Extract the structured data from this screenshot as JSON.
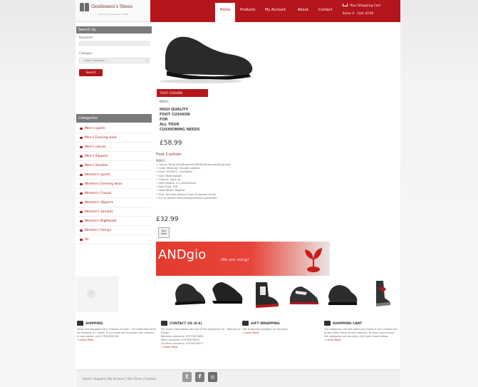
{
  "header": {
    "logo_text": "Gentlemen's Shoes",
    "logo_tagline": "Quality footwear since 1985",
    "nav": [
      "Home",
      "Products",
      "My Account",
      "About",
      "Contact"
    ],
    "cart_title": "Your Shopping Cart",
    "cart_items": "Items: 0",
    "cart_cost": "Cost: £0.00"
  },
  "search": {
    "heading": "Search by",
    "keywords_label": "Keywords",
    "category_label": "Category",
    "category_value": "-- Select Category --",
    "button_label": "Search"
  },
  "categories": {
    "heading": "Categories",
    "items": [
      "Men's sports",
      "Men's Evening wear",
      "Men's casual",
      "Men's Slippers",
      "Men's Sandals",
      "Women's sports",
      "Women's Evening wear",
      "Women's Casual",
      "Women's Slippers",
      "Women's Sandals",
      "Women's Nightwear",
      "Women's Pumps",
      "All"
    ]
  },
  "product": {
    "title": "FOOT CUSHION",
    "brand": "MEN'S",
    "description": [
      "HIGH QUALITY",
      "FOOT CUSHION",
      "FOR",
      "ALL YOUR",
      "CUSHIONING NEEDS"
    ],
    "price": "£58.99",
    "sub_title_prefix": "Foot",
    "sub_title_accent": "Cushion",
    "sub_brand": "MEN'S",
    "specs": [
      "Colour: Burgundy/Burgundy/White Burgundy/Burgundy",
      "Outer Material: Smooth Leather",
      "Inner: ROSSI'S - Synthetic",
      "Sole: Both Rubber",
      "Closure: Lace-up",
      "Heel Height: 1-2 centimetres",
      "Heel Type: Flat",
      "Shoe Width: Regular",
      "Free, tax-free delivery from European Union",
      "Full or partial refund/replacement guarantee"
    ],
    "price2": "£32.99",
    "buy_label_1": "Buy",
    "buy_label_2": "Now"
  },
  "banner": {
    "brand": "ANDgio",
    "tagline": "- We are rising!"
  },
  "footer": {
    "columns": [
      {
        "heading": "SHIPPING",
        "text": "Items are shipped every Tuesday at 3pm. The estimated time for delivery is 1 week. If you have not received your product in two weeks, call 07525656785.",
        "link": "» Learn More"
      },
      {
        "heading": "CONTACT US (9-6)",
        "text": "For more information call one of the following 9-6 - Monday to Friday:",
        "bullets": [
          "Womens products: 07071825691",
          "Mens products: 07976479876",
          "All other concerns: 07534749217"
        ],
        "link": "» Learn More"
      },
      {
        "heading": "GIFT WRAPPING",
        "text": "Gift wrapping available at checkout",
        "link": "» Learn More"
      },
      {
        "heading": "SHOPPING CART",
        "text": "Our shopping cart will store your items if you choose not to purchase these at the moment, to learn more about the shopping cart process, click learn more below.",
        "link": "» Learn More"
      }
    ],
    "links": "Home  |  Support  |  My Account  |  Site Terms  |  Contact"
  },
  "colors": {
    "brand_red": "#b4161c",
    "sidebar_header": "#7a7a7a"
  }
}
